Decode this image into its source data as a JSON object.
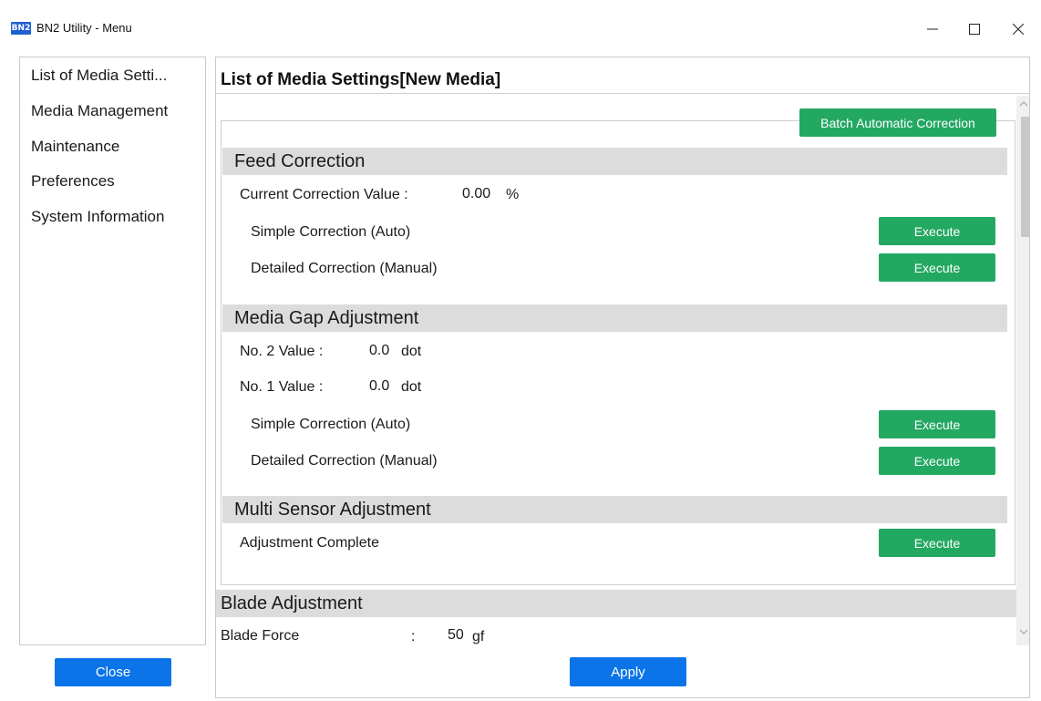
{
  "window": {
    "icon_text": "BN2",
    "title": "BN2 Utility - Menu"
  },
  "sidebar": {
    "items": [
      {
        "label": "List of Media Setti..."
      },
      {
        "label": "Media Management"
      },
      {
        "label": "Maintenance"
      },
      {
        "label": "Preferences"
      },
      {
        "label": "System Information"
      }
    ],
    "close_label": "Close"
  },
  "main": {
    "title": "List of Media Settings[New Media]",
    "batch_button": "Batch Automatic Correction",
    "feed_correction": {
      "header": "Feed Correction",
      "current_label": "Current Correction Value :",
      "current_value": "0.00",
      "current_unit": "%",
      "simple_label": "Simple Correction (Auto)",
      "detailed_label": "Detailed Correction (Manual)",
      "execute_label": "Execute"
    },
    "media_gap": {
      "header": "Media Gap Adjustment",
      "no2_label": "No. 2 Value :",
      "no2_value": "0.0",
      "no2_unit": "dot",
      "no1_label": "No. 1 Value :",
      "no1_value": "0.0",
      "no1_unit": "dot",
      "simple_label": "Simple Correction (Auto)",
      "detailed_label": "Detailed Correction (Manual)",
      "execute_label": "Execute"
    },
    "multi_sensor": {
      "header": "Multi Sensor Adjustment",
      "status_label": "Adjustment Complete",
      "execute_label": "Execute"
    },
    "blade": {
      "header": "Blade Adjustment",
      "force_label": "Blade Force",
      "force_sep": ":",
      "force_value": "50",
      "force_unit": "gf"
    },
    "apply_label": "Apply"
  },
  "colors": {
    "accent_blue": "#0a74e8",
    "action_green": "#23a862",
    "section_gray": "#dcdcdc"
  }
}
